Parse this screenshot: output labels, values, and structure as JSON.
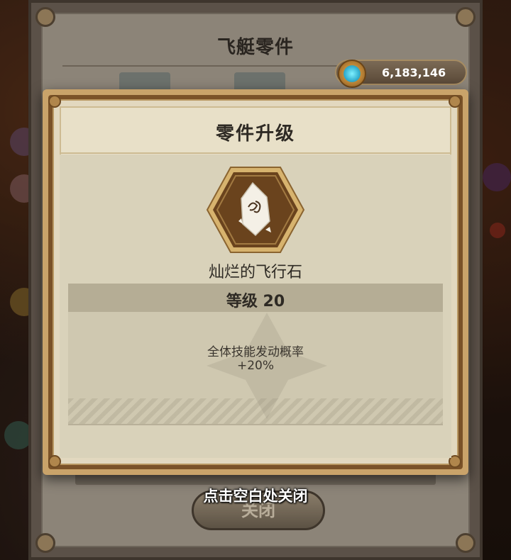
{
  "back_panel": {
    "title": "飞艇零件",
    "close_label": "关闭"
  },
  "currency": {
    "icon": "gear-crystal-icon",
    "amount": "6,183,146"
  },
  "dialog": {
    "title": "零件升级",
    "item": {
      "icon": "flying-stone-icon",
      "name": "灿烂的飞行石"
    },
    "level_label": "等级 20",
    "effect": {
      "name": "全体技能发动概率",
      "value": "+20%"
    }
  },
  "hint": "点击空白处关闭",
  "colors": {
    "dialog_gold": "#c9a36a",
    "hex_bronze": "#6a431d",
    "parchment": "#e8e0c8"
  }
}
